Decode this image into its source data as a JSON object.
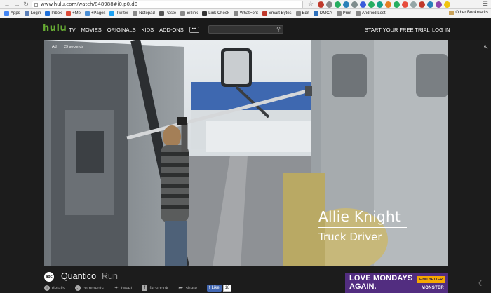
{
  "browser": {
    "url": "www.hulu.com/watch/848988#i0,p0,d0",
    "bookmarks": [
      {
        "label": "Apps",
        "color": "#4285f4"
      },
      {
        "label": "Login",
        "color": "#5b7fb8"
      },
      {
        "label": "Inbox",
        "color": "#1e6fd9"
      },
      {
        "label": "+Me",
        "color": "#dd4b39"
      },
      {
        "label": "+Pages",
        "color": "#4b8fd6"
      },
      {
        "label": "Twitter",
        "color": "#1da1f2"
      },
      {
        "label": "Notepad",
        "color": "#888888"
      },
      {
        "label": "Paste",
        "color": "#555555"
      },
      {
        "label": "Bitlink",
        "color": "#888888"
      },
      {
        "label": "Link Check",
        "color": "#333333"
      },
      {
        "label": "WhatFont",
        "color": "#888888"
      },
      {
        "label": "Smart Bytes",
        "color": "#c0392b"
      },
      {
        "label": "Edit",
        "color": "#888888"
      },
      {
        "label": "DMCA",
        "color": "#2c6fbb"
      },
      {
        "label": "Print",
        "color": "#888888"
      },
      {
        "label": "Android Lost",
        "color": "#888888"
      }
    ],
    "other_bookmarks": "Other Bookmarks"
  },
  "header": {
    "logo": "hulu",
    "logo_color": "#66aa33",
    "nav": [
      "TV",
      "MOVIES",
      "ORIGINALS",
      "KIDS",
      "ADD-ONS"
    ],
    "more": "•••",
    "trial": "START YOUR FREE TRIAL",
    "login": "LOG IN"
  },
  "video": {
    "ad_label": "Ad",
    "ad_time": "29 seconds",
    "name": "Allie Knight",
    "role": "Truck Driver"
  },
  "show": {
    "network": "abc",
    "title": "Quantico",
    "episode": "Run"
  },
  "actions": {
    "details": "details",
    "comments": "comments",
    "tweet": "tweet",
    "facebook": "facebook",
    "share": "share",
    "like": "Like",
    "like_count": "18"
  },
  "ad_banner": {
    "line1": "LOVE MONDAYS",
    "line2": "AGAIN.",
    "cta": "FIND BETTER",
    "brand": "MONSTER",
    "color": "#522d80"
  }
}
